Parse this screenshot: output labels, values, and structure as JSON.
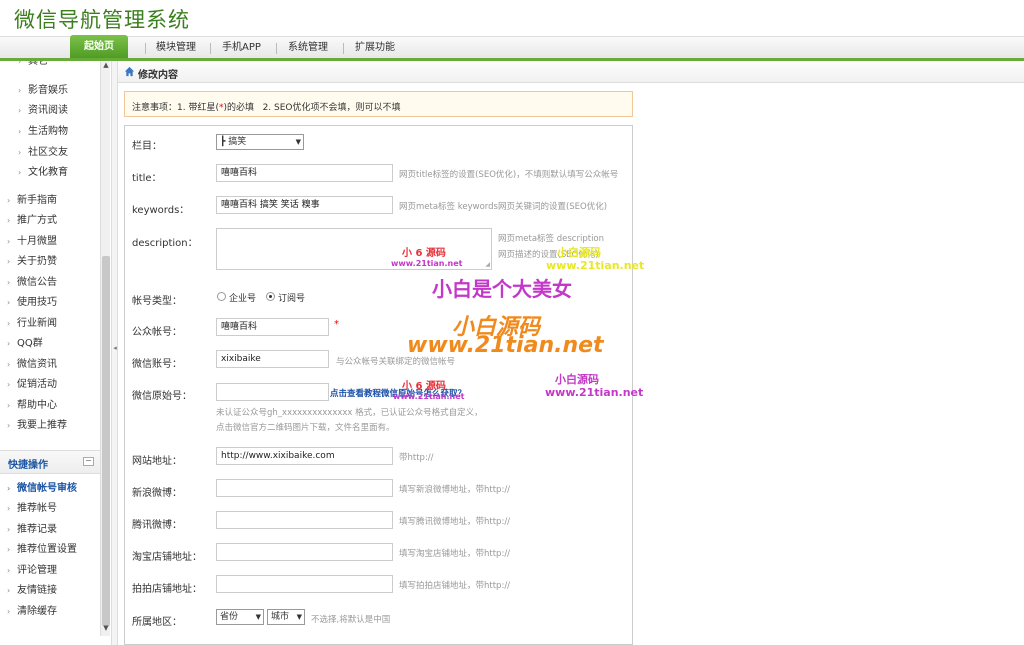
{
  "app": {
    "title": "微信导航管理系统"
  },
  "topnav": {
    "tabs": [
      {
        "label": "起始页",
        "active": true
      },
      {
        "label": "模块管理"
      },
      {
        "label": "手机APP"
      },
      {
        "label": "系统管理"
      },
      {
        "label": "扩展功能"
      }
    ]
  },
  "sidebar": {
    "sub_items": [
      "其它",
      "影音娱乐",
      "资讯阅读",
      "生活购物",
      "社区交友",
      "文化教育"
    ],
    "items": [
      "新手指南",
      "推广方式",
      "十月微盟",
      "关于扔赞",
      "微信公告",
      "使用技巧",
      "行业新闻",
      "QQ群",
      "微信资讯",
      "促销活动",
      "帮助中心",
      "我要上推荐"
    ],
    "quick_title": "快捷操作",
    "quick_items": [
      "微信帐号审核",
      "推荐帐号",
      "推荐记录",
      "推荐位置设置",
      "评论管理",
      "友情链接",
      "清除缓存"
    ]
  },
  "breadcrumb": {
    "label": "修改内容"
  },
  "notice": {
    "prefix": "注意事项：1. 带红星(",
    "star": "*",
    "suffix": ")的必填",
    "item2": "2. SEO优化项不会填，则可以不填"
  },
  "form": {
    "category": {
      "label": "栏目：",
      "value": "┣ 搞笑"
    },
    "title": {
      "label": "title：",
      "value": "嘻嘻百科",
      "hint": "网页title标签的设置(SEO优化)，不填则默认填写公众帐号"
    },
    "keywords": {
      "label": "keywords：",
      "value": "嘻嘻百科 搞笑 笑话 糗事",
      "hint": "网页meta标签 keywords网页关键词的设置(SEO优化)"
    },
    "description": {
      "label": "description：",
      "value": "",
      "hint1": "网页meta标签 description",
      "hint2": "网页描述的设置(SEO优化)"
    },
    "account_type": {
      "label": "帐号类型：",
      "options": [
        "企业号",
        "订阅号"
      ],
      "selected": "订阅号"
    },
    "public_account": {
      "label": "公众帐号：",
      "value": "嘻嘻百科",
      "required": "*"
    },
    "wechat_id": {
      "label": "微信账号：",
      "value": "xixibaike",
      "hint": "与公众帐号关联绑定的微信帐号"
    },
    "original_id": {
      "label": "微信原始号：",
      "value": "",
      "link": "点击查看教程微信原始号怎么获取？",
      "hint1": "未认证公众号gh_xxxxxxxxxxxxxx 格式，已认证公众号格式自定义，",
      "hint2": "点击微信官方二维码图片下载，文件名里面有。"
    },
    "website": {
      "label": "网站地址：",
      "value": "http://www.xixibaike.com",
      "hint": "带http://"
    },
    "weibo_sina": {
      "label": "新浪微博：",
      "value": "",
      "hint": "填写新浪微博地址，带http://"
    },
    "weibo_tencent": {
      "label": "腾讯微博：",
      "value": "",
      "hint": "填写腾讯微博地址，带http://"
    },
    "taobao": {
      "label": "淘宝店铺地址：",
      "value": "",
      "hint": "填写淘宝店铺地址，带http://"
    },
    "paipai": {
      "label": "拍拍店铺地址：",
      "value": "",
      "hint": "填写拍拍店铺地址，带http://"
    },
    "region": {
      "label": "所属地区：",
      "province": "省份",
      "city": "城市",
      "hint": "不选择,将默认是中国"
    }
  },
  "watermarks": {
    "a1": "小 6 源码",
    "a2": "www.21tian.net",
    "b1": "小白源码",
    "b2": "www.21tian.net",
    "big1": "小白是个大美女",
    "big2": "小白源码",
    "big3": "www.21tian.net",
    "c1": "小白源码",
    "c2": "www.21tian.net",
    "d1": "小 6 源码",
    "d2": "www.21tian.net"
  }
}
